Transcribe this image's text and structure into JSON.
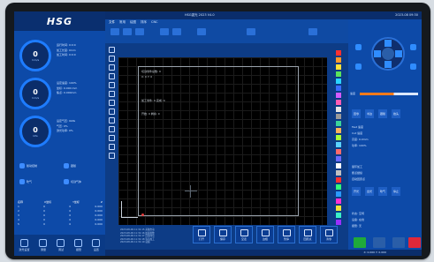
{
  "app": {
    "logo": "HSG",
    "title": "HSG激光 2023 V4.0",
    "window_right": "2023-08 09:30"
  },
  "ribbon": {
    "tabs": [
      "文件",
      "常用",
      "绘图",
      "排序",
      "CNC"
    ],
    "active_tab": "文件"
  },
  "left_panel": {
    "gauges": [
      {
        "value": "0",
        "unit": "mm/s"
      },
      {
        "value": "0",
        "unit": "mm/s"
      },
      {
        "value": "0",
        "unit": "kPa"
      }
    ],
    "info_blocks": [
      [
        "运行时间: 0:0:0",
        "加工长度: 0mm",
        "加工时间: 0:0:0"
      ],
      [
        "设定速度: 100%",
        "坐标: 0.000 mm",
        "焦点: 0.000mm"
      ],
      [
        "设定气压: 0kPa",
        "气压: 0%",
        "激光功率: 0%"
      ]
    ],
    "buttons": [
      "随动控制",
      "跟随",
      "吹气",
      "切割气体"
    ],
    "table_headers": [
      "名称",
      "X坐标",
      "Y坐标",
      "Z"
    ],
    "table_rows": [
      [
        "1",
        "0",
        "0",
        "0.000"
      ],
      [
        "2",
        "0",
        "0",
        "0.000"
      ],
      [
        "3",
        "0",
        "0",
        "0.000"
      ],
      [
        "4",
        "0",
        "0",
        "0.000"
      ],
      [
        "5",
        "0",
        "0",
        "0.000"
      ]
    ],
    "bottom_tools": [
      "激光设置",
      "测量",
      "调试",
      "报警",
      "设置"
    ]
  },
  "canvas": {
    "notes": [
      "切割零件总数: 0",
      "X: 0  Y: 0",
      "加工零件: 0  完成: 0",
      "开始: 0  剩余: 0"
    ],
    "palette": [
      "#ff3030",
      "#ff9a2a",
      "#ffe23a",
      "#5be55b",
      "#2ad4ff",
      "#3a6cff",
      "#d45bff",
      "#ff5bb4",
      "#e6e6e6",
      "#9a9a9a",
      "#3ad49a",
      "#ffb15b",
      "#a8ff3a",
      "#5bd2ff",
      "#ff6a6a",
      "#6a6aff",
      "#ffffff",
      "#c0c0c0",
      "#ff3030",
      "#30ff7a",
      "#2a9aff",
      "#ff30d4",
      "#f0e63a",
      "#3af0c8",
      "#9a30ff"
    ]
  },
  "commands": [
    "打开",
    "保存",
    "空走",
    "边框",
    "暂停",
    "回原点",
    "清零"
  ],
  "log": [
    "2023-08-09 11:31:15 系统启动",
    "2023-08-09 11:31:16 加载参数",
    "2023-08-09 11:31:17 连接成功",
    "2023-08-09 11:31:18 等待加工",
    "2023-08-09 11:31:19 就绪"
  ],
  "right_panel": {
    "speed_label": "速度",
    "slider_value": 0.58,
    "labels": [
      "手动速度",
      "步距",
      "高速",
      "切割",
      "调高器"
    ],
    "buttons_row1": [
      "回零",
      "寻边",
      "跟随",
      "抬头"
    ],
    "buttons_row2": [
      "开光",
      "出光",
      "吹气",
      "停止"
    ],
    "params": [
      "Fast 速度",
      "Cut 速度",
      "高度: 0.0mm",
      "功率: 100%"
    ],
    "options": [
      "循环加工",
      "断点继续",
      "自动回原点"
    ],
    "status": [
      "状态: 空闲",
      "设备: 在线",
      "报警: 无"
    ],
    "footer": [
      "开始",
      "暂停",
      "停止"
    ]
  },
  "statusbar": {
    "right": "X: 0.000  Y: 0.000"
  }
}
